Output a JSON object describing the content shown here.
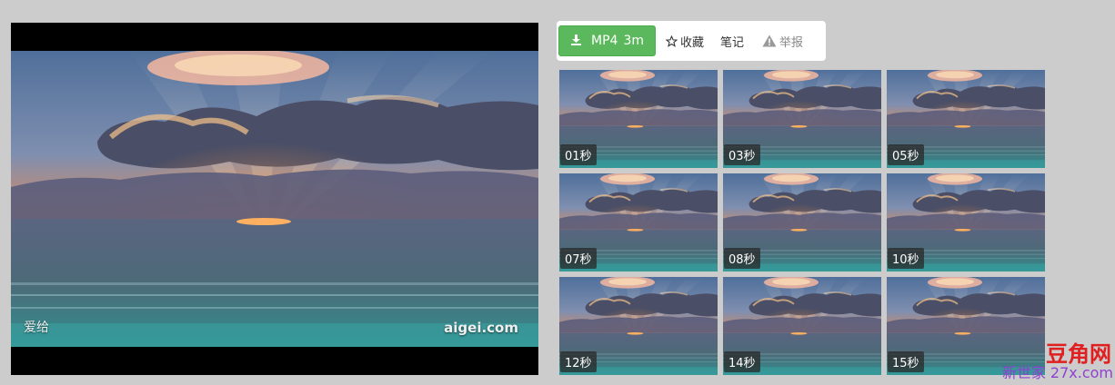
{
  "player": {
    "watermark_left": "爱给",
    "watermark_right": "aigei.com"
  },
  "toolbar": {
    "download_format": "MP4",
    "download_duration": "3m",
    "favorite_label": "收藏",
    "notes_label": "笔记",
    "report_label": "举报",
    "icons": {
      "download": "download-icon",
      "favorite": "star-outline-icon",
      "report": "warning-icon"
    },
    "colors": {
      "download_bg": "#5cb85c"
    }
  },
  "thumbnails": [
    {
      "time": "01秒"
    },
    {
      "time": "03秒"
    },
    {
      "time": "05秒"
    },
    {
      "time": "07秒"
    },
    {
      "time": "08秒"
    },
    {
      "time": "10秒"
    },
    {
      "time": "12秒"
    },
    {
      "time": "14秒"
    },
    {
      "time": "15秒"
    }
  ],
  "site_logo": {
    "line1": "豆角网",
    "line2": "新世家 27x.com"
  }
}
